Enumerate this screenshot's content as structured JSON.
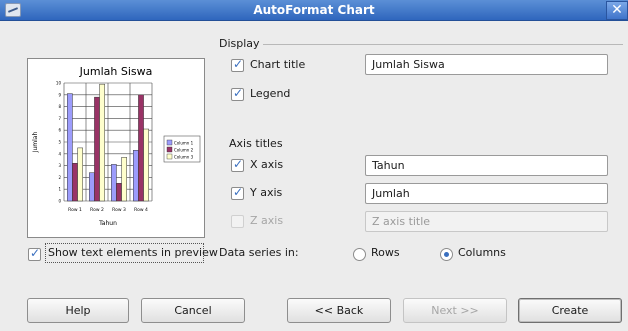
{
  "window": {
    "title": "AutoFormat Chart",
    "close_glyph": "✕"
  },
  "preview": {
    "show_text_label": "Show text elements in preview",
    "show_text_checked": true
  },
  "chart_data": {
    "type": "bar",
    "title": "Jumlah Siswa",
    "xlabel": "Tahun",
    "ylabel": "Jumlah",
    "categories": [
      "Row 1",
      "Row 2",
      "Row 3",
      "Row 4"
    ],
    "ylim": [
      0,
      10
    ],
    "yticks": [
      "10",
      "9",
      "8",
      "7",
      "6",
      "5",
      "4",
      "3",
      "2",
      "1",
      "0"
    ],
    "series": [
      {
        "name": "Column 1",
        "values": [
          9.1,
          2.4,
          3.1,
          4.3
        ],
        "color": "#9c9cfc"
      },
      {
        "name": "Column 2",
        "values": [
          3.2,
          8.8,
          1.5,
          9.0
        ],
        "color": "#993366"
      },
      {
        "name": "Column 3",
        "values": [
          4.5,
          9.9,
          3.7,
          6.1
        ],
        "color": "#ffffcc"
      }
    ],
    "grid": true,
    "legend_position": "right"
  },
  "display": {
    "section_title": "Display",
    "chart_title_label": "Chart title",
    "chart_title_checked": true,
    "chart_title_value": "Jumlah Siswa",
    "legend_label": "Legend",
    "legend_checked": true
  },
  "axis_titles": {
    "section_title": "Axis titles",
    "x_label": "X axis",
    "x_checked": true,
    "x_value": "Tahun",
    "y_label": "Y axis",
    "y_checked": true,
    "y_value": "Jumlah",
    "z_label": "Z axis",
    "z_checked": false,
    "z_placeholder": "Z axis title"
  },
  "data_series": {
    "label": "Data series in:",
    "rows_label": "Rows",
    "columns_label": "Columns",
    "selected": "Columns"
  },
  "buttons": {
    "help": "Help",
    "cancel": "Cancel",
    "back": "<< Back",
    "next": "Next >>",
    "create": "Create"
  }
}
